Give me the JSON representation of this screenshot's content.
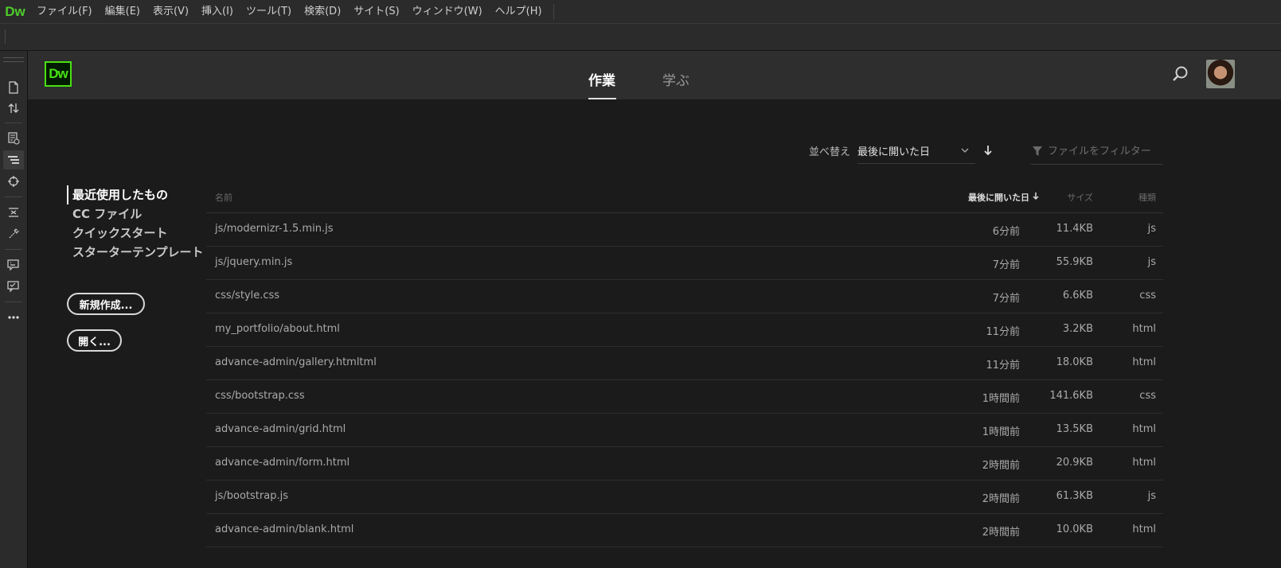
{
  "app": {
    "logo_small": "Dw",
    "logo": "Dw"
  },
  "menu": [
    "ファイル(F)",
    "編集(E)",
    "表示(V)",
    "挿入(I)",
    "ツール(T)",
    "検索(D)",
    "サイト(S)",
    "ウィンドウ(W)",
    "ヘルプ(H)"
  ],
  "tabs": {
    "work": "作業",
    "learn": "学ぶ"
  },
  "nav": {
    "items": [
      "最近使用したもの",
      "CC ファイル",
      "クイックスタート",
      "スターターテンプレート"
    ]
  },
  "buttons": {
    "new": "新規作成...",
    "open": "開く..."
  },
  "sort": {
    "label": "並べ替え",
    "selected": "最後に開いた日"
  },
  "filter": {
    "placeholder": "ファイルをフィルター"
  },
  "table": {
    "headers": {
      "name": "名前",
      "date": "最後に開いた日",
      "size": "サイズ",
      "type": "種類"
    },
    "rows": [
      {
        "name": "js/modernizr-1.5.min.js",
        "date": "6分前",
        "size": "11.4KB",
        "type": "js"
      },
      {
        "name": "js/jquery.min.js",
        "date": "7分前",
        "size": "55.9KB",
        "type": "js"
      },
      {
        "name": "css/style.css",
        "date": "7分前",
        "size": "6.6KB",
        "type": "css"
      },
      {
        "name": "my_portfolio/about.html",
        "date": "11分前",
        "size": "3.2KB",
        "type": "html"
      },
      {
        "name": "advance-admin/gallery.htmltml",
        "date": "11分前",
        "size": "18.0KB",
        "type": "html"
      },
      {
        "name": "css/bootstrap.css",
        "date": "1時間前",
        "size": "141.6KB",
        "type": "css"
      },
      {
        "name": "advance-admin/grid.html",
        "date": "1時間前",
        "size": "13.5KB",
        "type": "html"
      },
      {
        "name": "advance-admin/form.html",
        "date": "2時間前",
        "size": "20.9KB",
        "type": "html"
      },
      {
        "name": "js/bootstrap.js",
        "date": "2時間前",
        "size": "61.3KB",
        "type": "js"
      },
      {
        "name": "advance-admin/blank.html",
        "date": "2時間前",
        "size": "10.0KB",
        "type": "html"
      }
    ]
  }
}
